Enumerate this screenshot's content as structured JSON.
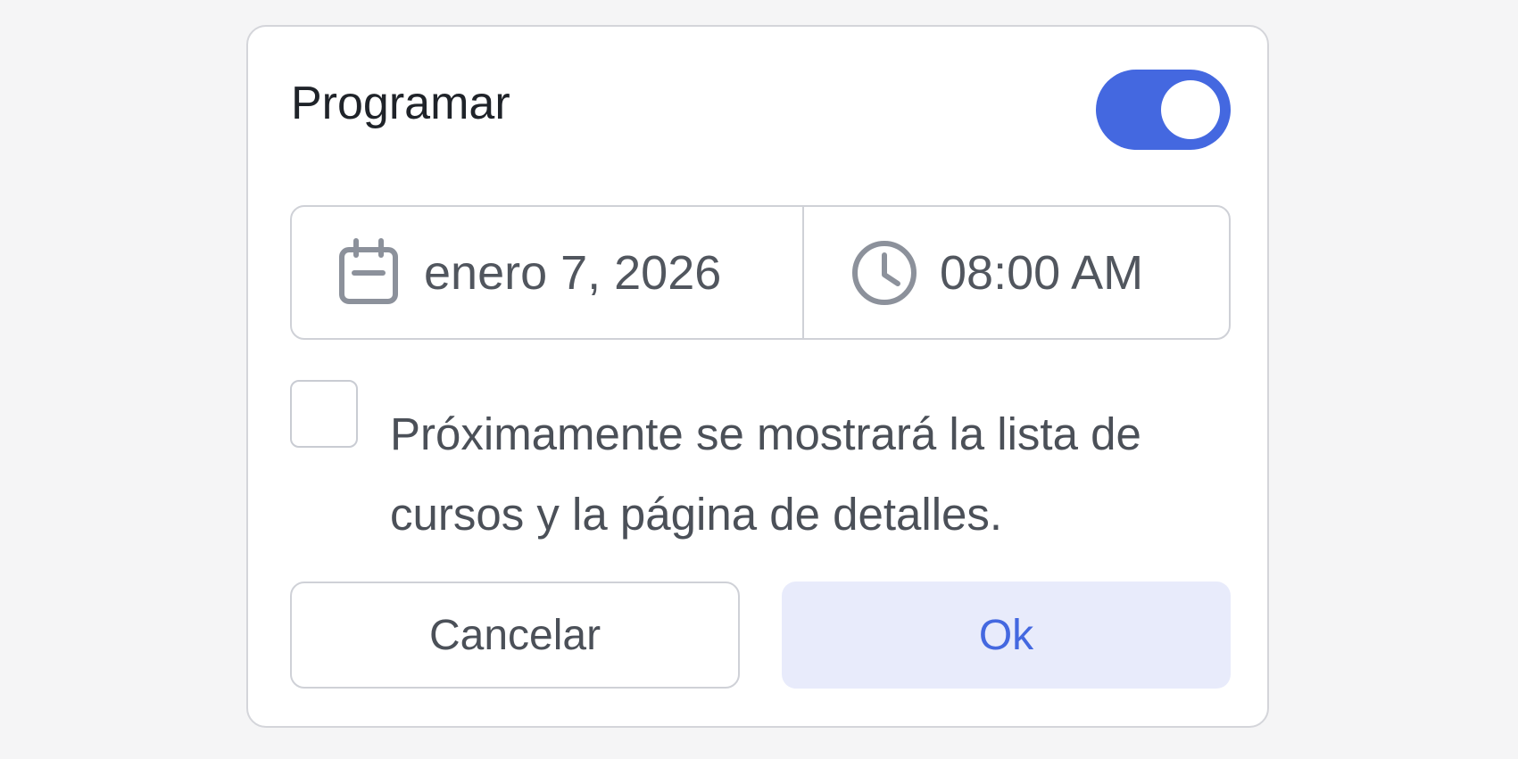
{
  "schedule": {
    "title": "Programar",
    "toggle_on": true,
    "accent_color": "#4468e0"
  },
  "date_time": {
    "date_value": "enero 7, 2026",
    "time_value": "08:00 AM",
    "date_icon": "calendar-icon",
    "time_icon": "clock-icon"
  },
  "notice": {
    "checked": false,
    "text": "Próximamente se mostrará la lista de cursos y la página de detalles."
  },
  "buttons": {
    "cancel_label": "Cancelar",
    "ok_label": "Ok",
    "ok_color": "#4468e0"
  }
}
